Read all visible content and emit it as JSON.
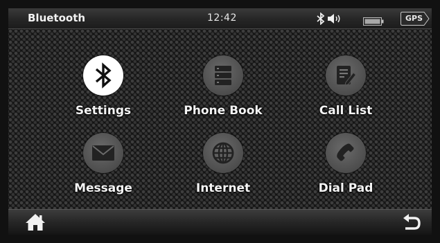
{
  "status_bar": {
    "title": "Bluetooth",
    "time": "12:42",
    "gps_label": "GPS",
    "icons": [
      "bluetooth-status-icon",
      "volume-icon",
      "battery-icon"
    ]
  },
  "menu": {
    "items": [
      {
        "label": "Settings",
        "icon": "bluetooth-icon",
        "active": true
      },
      {
        "label": "Phone Book",
        "icon": "phonebook-icon",
        "active": false
      },
      {
        "label": "Call List",
        "icon": "call-list-icon",
        "active": false
      },
      {
        "label": "Message",
        "icon": "envelope-icon",
        "active": false
      },
      {
        "label": "Internet",
        "icon": "globe-icon",
        "active": false
      },
      {
        "label": "Dial Pad",
        "icon": "phone-handset-icon",
        "active": false
      }
    ]
  },
  "bottom_bar": {
    "icons": [
      "home-icon",
      "back-icon"
    ]
  },
  "colors": {
    "active_circle": "#ffffff",
    "inactive_circle": "#555555",
    "label_text": "#f4f4f4"
  }
}
